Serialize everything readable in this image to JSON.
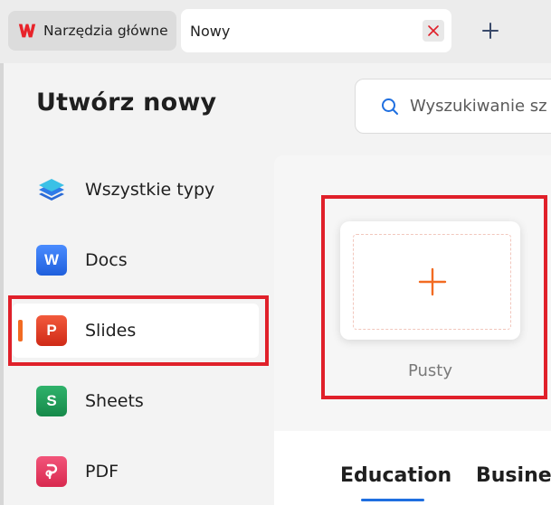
{
  "tabs": {
    "home_label": "Narzędzia główne",
    "new_label": "Nowy"
  },
  "page": {
    "title": "Utwórz nowy"
  },
  "search": {
    "placeholder": "Wyszukiwanie sz"
  },
  "sidebar": {
    "items": [
      {
        "label": "Wszystkie typy",
        "icon": "layers-icon"
      },
      {
        "label": "Docs",
        "icon": "docs-icon",
        "glyph": "W"
      },
      {
        "label": "Slides",
        "icon": "slides-icon",
        "glyph": "P",
        "active": true
      },
      {
        "label": "Sheets",
        "icon": "sheets-icon",
        "glyph": "S"
      },
      {
        "label": "PDF",
        "icon": "pdf-icon"
      }
    ]
  },
  "templates": {
    "blank_label": "Pusty"
  },
  "categories": {
    "items": [
      "Education",
      "Business"
    ]
  },
  "colors": {
    "accent": "#f26b22",
    "highlight": "#e0202a",
    "link": "#1f6fe0"
  }
}
